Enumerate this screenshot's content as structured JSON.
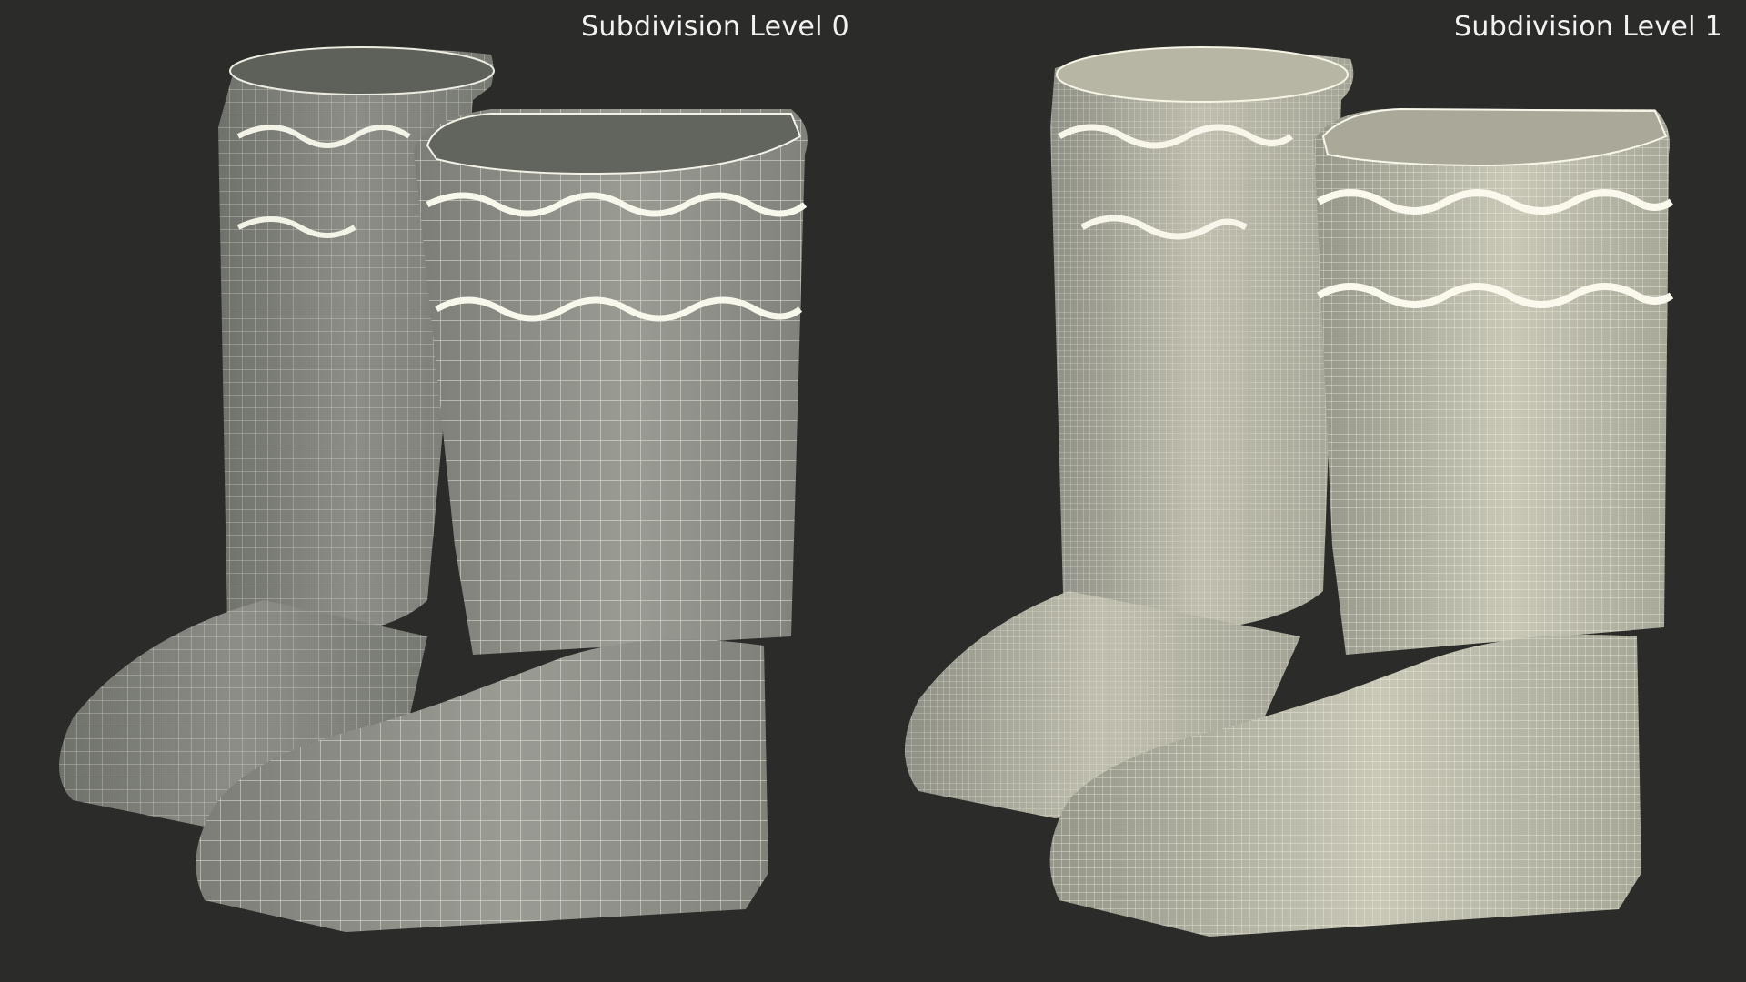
{
  "panels": [
    {
      "label": "Subdivision Level 0"
    },
    {
      "label": "Subdivision Level 1"
    }
  ],
  "colors": {
    "background": "#2b2b2a",
    "mesh_fill_dark": "#8f918a",
    "mesh_fill_light": "#c7c6b6",
    "wire_level0": "#e8e8dc",
    "wire_level1": "#f4f2e2"
  }
}
